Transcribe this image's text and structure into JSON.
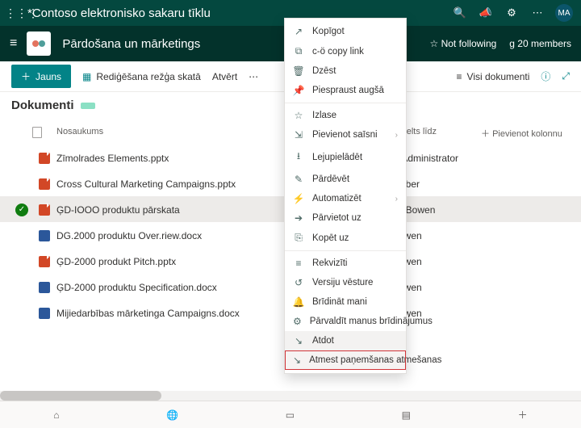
{
  "topbar": {
    "title": "*Contoso elektronisko sakaru tīklu",
    "avatar": "MA"
  },
  "site": {
    "name": "Pārdošana un mārketings",
    "not_following": "Not following",
    "members": "g 20 members"
  },
  "cmdbar": {
    "new": "Jauns",
    "edit_grid": "Rediģēšana režģa skatā",
    "open": "Atvērt",
    "view_all": "Visi dokumenti"
  },
  "library": {
    "title": "Dokumenti"
  },
  "columns": {
    "name": "Nosaukums",
    "modified": "pacelts līdz",
    "add": "Pievienot kolonnu"
  },
  "rows": [
    {
      "type": "ppt",
      "name": "Zīmolrades Elements.pptx",
      "modified": "D Administrator"
    },
    {
      "type": "ppt",
      "name": "Cross Cultural Marketing Campaigns.pptx",
      "modified": "Wilber",
      "err": true
    },
    {
      "type": "ppt",
      "name": "ĢD-IOOO produktu pārskata",
      "modified": "en Bowen",
      "selected": true,
      "checked": true
    },
    {
      "type": "doc",
      "name": "DG.2000 produktu Over.riew.docx",
      "modified": "Bowen",
      "err": true
    },
    {
      "type": "ppt",
      "name": "ĢD-2000 produkt Pitch.pptx",
      "modified": "Bowen"
    },
    {
      "type": "doc",
      "name": "ĢD-2000 produktu Specification.docx",
      "modified": "Bowen"
    },
    {
      "type": "doc",
      "name": "Mijiedarbības mārketinga Campaigns.docx",
      "modified": "Bowen"
    }
  ],
  "menu": [
    {
      "icon": "↗",
      "label": "Kopīgot"
    },
    {
      "icon": "⧉",
      "label": "c-ö copy link"
    },
    {
      "icon": "🗑",
      "label": "Dzēst"
    },
    {
      "icon": "📌",
      "label": "Piespraust augšā"
    },
    {
      "sep": true
    },
    {
      "icon": "☆",
      "label": "Izlase"
    },
    {
      "icon": "⇲",
      "label": "Pievienot saīsni",
      "sub": true
    },
    {
      "icon": "⭳",
      "label": "Lejupielādēt"
    },
    {
      "icon": "✎",
      "label": "Pārdēvēt"
    },
    {
      "icon": "⚡",
      "label": "Automatizēt",
      "sub": true
    },
    {
      "icon": "➔",
      "label": "Pārvietot uz"
    },
    {
      "icon": "⎘",
      "label": "Kopēt uz"
    },
    {
      "sep": true
    },
    {
      "icon": "≡",
      "label": "Rekvizīti"
    },
    {
      "icon": "↺",
      "label": "Versiju vēsture"
    },
    {
      "icon": "🔔",
      "label": "Brīdināt mani"
    },
    {
      "icon": "⚙",
      "label": "Pārvaldīt manus brīdinājumus"
    },
    {
      "icon": "↘",
      "label": "Atdot",
      "hover": true
    },
    {
      "icon": "↘",
      "label": "Atmest paņemšanas atmešanas",
      "hl": true
    }
  ]
}
